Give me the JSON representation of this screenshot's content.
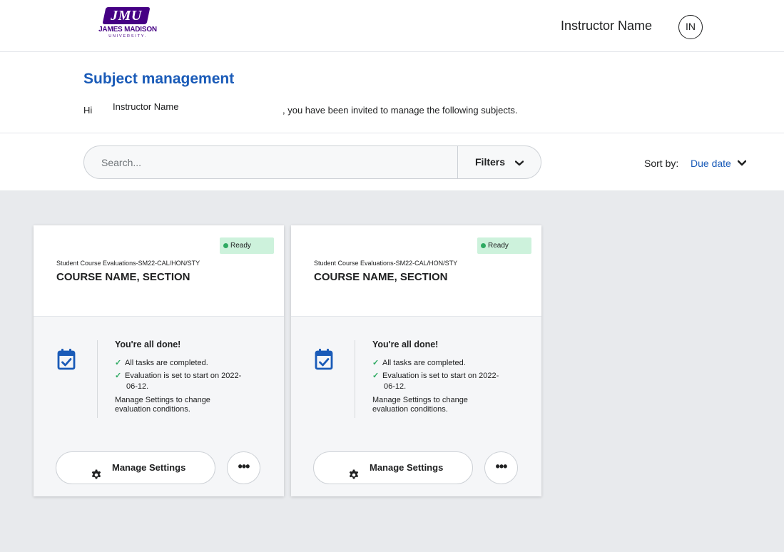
{
  "header": {
    "logo_mark": "JMU",
    "logo_line1": "JAMES MADISON",
    "logo_line2": "UNIVERSITY.",
    "user_name": "Instructor Name",
    "avatar_initials": "IN"
  },
  "page": {
    "title": "Subject management",
    "greeting_hi": "Hi",
    "greeting_name": "Instructor Name",
    "greeting_rest": ", you have been invited to manage the following subjects."
  },
  "toolbar": {
    "search_placeholder": "Search...",
    "filters_label": "Filters",
    "sort_label": "Sort by:",
    "sort_value": "Due date"
  },
  "colors": {
    "brand_purple": "#450084",
    "link_blue": "#1a5bb8",
    "ready_bg": "#cdf2dc",
    "ready_dot": "#2eaa62"
  },
  "cards": [
    {
      "status": "Ready",
      "subtitle": "Student Course Evaluations-SM22-CAL/HON/STY",
      "title": "COURSE NAME, SECTION",
      "done_title": "You're all done!",
      "check1": "All tasks are completed.",
      "check2_a": "Evaluation is set to start on 2022-",
      "check2_b": "06-12.",
      "note": "Manage Settings to change evaluation conditions.",
      "manage_label": "Manage Settings",
      "more_label": "•••",
      "icon": "calendar-check-icon"
    },
    {
      "status": "Ready",
      "subtitle": "Student Course Evaluations-SM22-CAL/HON/STY",
      "title": "COURSE NAME, SECTION",
      "done_title": "You're all done!",
      "check1": "All tasks are completed.",
      "check2_a": "Evaluation is set to start on 2022-",
      "check2_b": "06-12.",
      "note": "Manage Settings to change evaluation conditions.",
      "manage_label": "Manage Settings",
      "more_label": "•••",
      "icon": "calendar-check-icon"
    }
  ]
}
